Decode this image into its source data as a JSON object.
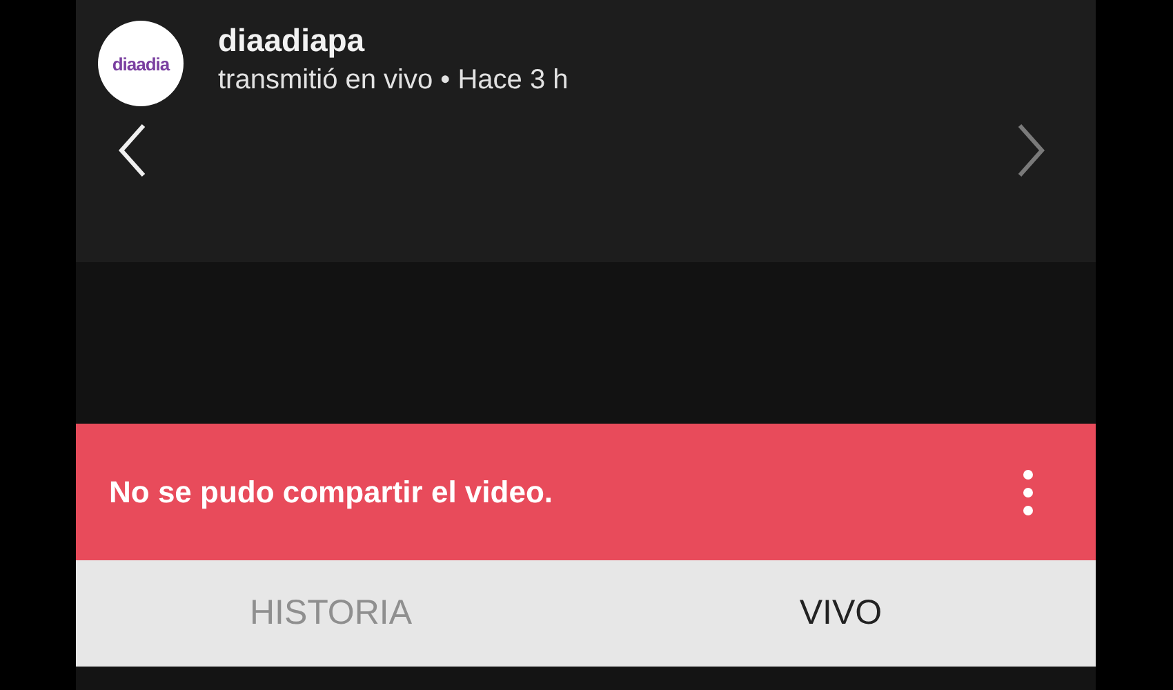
{
  "post_header": {
    "avatar_logo": "diaadia",
    "username": "diaadiapa",
    "subtitle": "transmitió en vivo • Hace 3 h"
  },
  "navigation": [
    {
      "kind": "back",
      "disabled": false
    },
    {
      "kind": "forward",
      "disabled": true
    }
  ],
  "error_banner": {
    "message": "No se pudo compartir el video."
  },
  "tabs": [
    {
      "label": "HISTORIA",
      "selected": false
    },
    {
      "label": "VIVO",
      "selected": true
    }
  ]
}
